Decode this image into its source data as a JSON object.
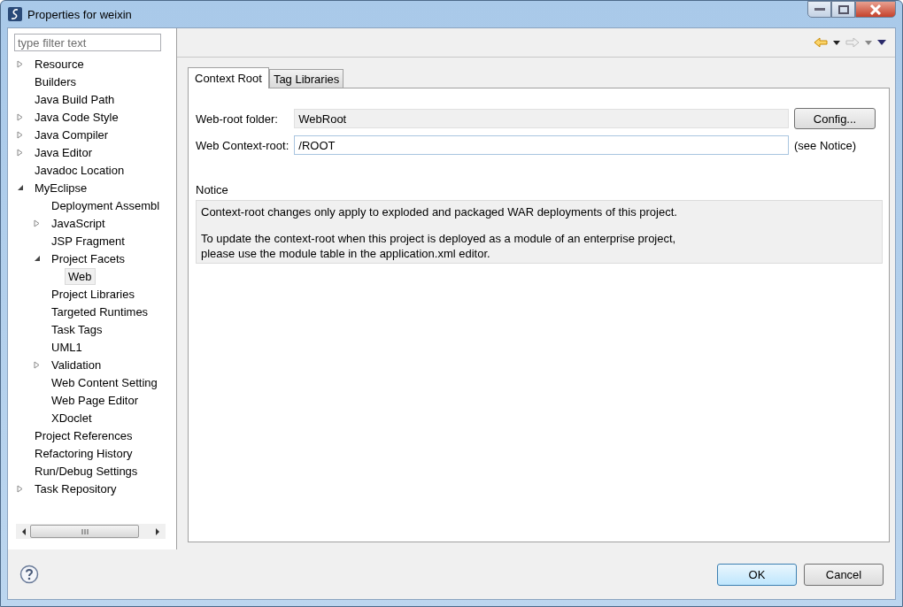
{
  "window": {
    "title": "Properties for weixin"
  },
  "filter": {
    "placeholder": "type filter text"
  },
  "tree": [
    {
      "label": "Resource",
      "expanded": false,
      "selected": false
    },
    {
      "label": "Builders",
      "selected": false
    },
    {
      "label": "Java Build Path",
      "selected": false
    },
    {
      "label": "Java Code Style",
      "expanded": false,
      "selected": false
    },
    {
      "label": "Java Compiler",
      "expanded": false,
      "selected": false
    },
    {
      "label": "Java Editor",
      "expanded": false,
      "selected": false
    },
    {
      "label": "Javadoc Location",
      "selected": false
    },
    {
      "label": "MyEclipse",
      "expanded": true,
      "selected": false,
      "children": [
        {
          "label": "Deployment Assembl",
          "selected": false
        },
        {
          "label": "JavaScript",
          "expanded": false,
          "selected": false
        },
        {
          "label": "JSP Fragment",
          "selected": false
        },
        {
          "label": "Project Facets",
          "expanded": true,
          "selected": false,
          "children": [
            {
              "label": "Web",
              "selected": true
            }
          ]
        },
        {
          "label": "Project Libraries",
          "selected": false
        },
        {
          "label": "Targeted Runtimes",
          "selected": false
        },
        {
          "label": "Task Tags",
          "selected": false
        },
        {
          "label": "UML1",
          "selected": false
        },
        {
          "label": "Validation",
          "expanded": false,
          "selected": false
        },
        {
          "label": "Web Content Setting",
          "selected": false
        },
        {
          "label": "Web Page Editor",
          "selected": false
        },
        {
          "label": "XDoclet",
          "selected": false
        }
      ]
    },
    {
      "label": "Project References",
      "selected": false
    },
    {
      "label": "Refactoring History",
      "selected": false
    },
    {
      "label": "Run/Debug Settings",
      "selected": false
    },
    {
      "label": "Task Repository",
      "expanded": false,
      "selected": false
    }
  ],
  "tabs": [
    {
      "label": "Context Root",
      "selected": true
    },
    {
      "label": "Tag Libraries",
      "selected": false
    }
  ],
  "fields": [
    {
      "label": "Web-root folder:",
      "value": "WebRoot",
      "disabled": true,
      "button": "Config..."
    },
    {
      "label": "Web Context-root:",
      "value": "/ROOT",
      "disabled": false,
      "hint": "(see Notice)"
    }
  ],
  "notice": {
    "title": "Notice",
    "paragraphs": [
      [
        "Context-root changes only apply to exploded and packaged WAR deployments of this project."
      ],
      [
        "To update the context-root when this project is deployed as a module of an enterprise project,",
        "please use the module table in the application.xml editor."
      ]
    ]
  },
  "buttons": [
    {
      "label": "OK",
      "default": true
    },
    {
      "label": "Cancel",
      "default": false
    }
  ]
}
